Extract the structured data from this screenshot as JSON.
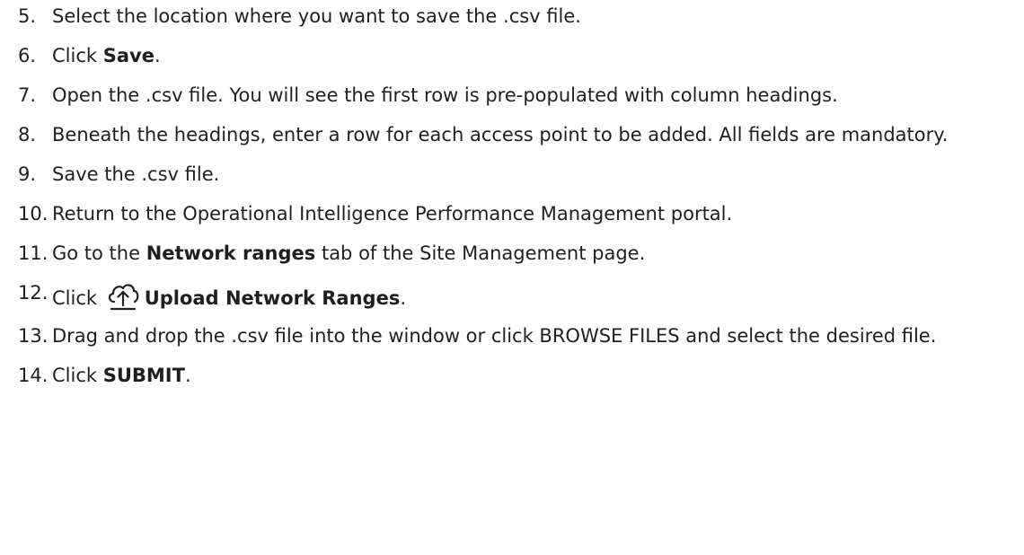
{
  "steps": [
    {
      "num": "5.",
      "parts": [
        {
          "t": "Select the location where you want to save the .csv file."
        }
      ]
    },
    {
      "num": "6.",
      "parts": [
        {
          "t": "Click "
        },
        {
          "t": "Save",
          "b": true
        },
        {
          "t": "."
        }
      ]
    },
    {
      "num": "7.",
      "parts": [
        {
          "t": "Open the .csv file. You will see the first row is pre-populated with column headings."
        }
      ]
    },
    {
      "num": "8.",
      "parts": [
        {
          "t": "Beneath the headings, enter a row for each access point to be added. All fields are mandatory."
        }
      ]
    },
    {
      "num": "9.",
      "parts": [
        {
          "t": "Save the .csv file."
        }
      ]
    },
    {
      "num": "10.",
      "parts": [
        {
          "t": "Return to the Operational Intelligence Performance Management portal."
        }
      ]
    },
    {
      "num": "11.",
      "parts": [
        {
          "t": "Go to the "
        },
        {
          "t": "Network ranges",
          "b": true
        },
        {
          "t": " tab of the Site Management page."
        }
      ]
    },
    {
      "num": "12.",
      "parts": [
        {
          "t": "Click "
        },
        {
          "icon": "cloud-upload-icon"
        },
        {
          "t": "Upload Network Ranges",
          "b": true
        },
        {
          "t": "."
        }
      ]
    },
    {
      "num": "13.",
      "parts": [
        {
          "t": "Drag and drop the .csv file into the window or click BROWSE FILES and select the desired file."
        }
      ]
    },
    {
      "num": "14.",
      "parts": [
        {
          "t": "Click "
        },
        {
          "t": "SUBMIT",
          "b": true
        },
        {
          "t": "."
        }
      ]
    }
  ]
}
